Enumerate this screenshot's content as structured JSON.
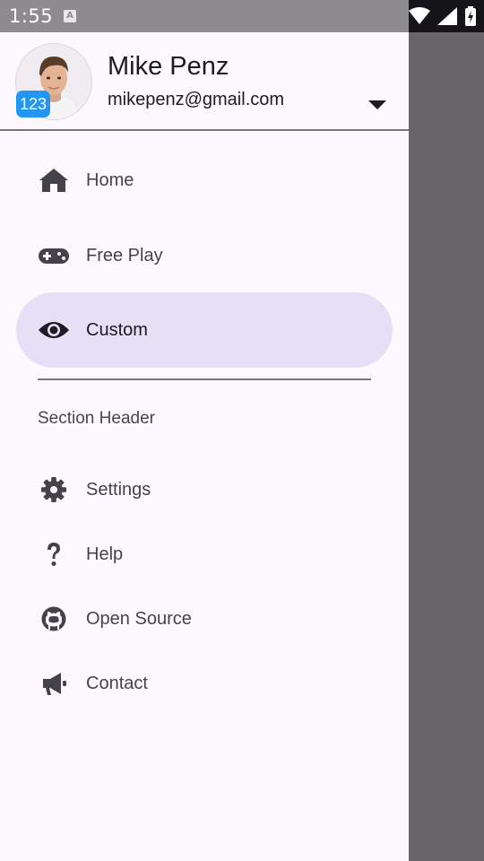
{
  "status_bar": {
    "time": "1:55",
    "a_icon": "A"
  },
  "profile": {
    "name": "Mike Penz",
    "email": "mikepenz@gmail.com",
    "badge": "123"
  },
  "nav": {
    "items": [
      {
        "label": "Home",
        "icon": "home-icon",
        "selected": false
      },
      {
        "label": "Free Play",
        "icon": "gamepad-icon",
        "selected": false
      },
      {
        "label": "Custom",
        "icon": "eye-icon",
        "selected": true
      }
    ],
    "section_header": "Section Header",
    "secondary_items": [
      {
        "label": "Settings",
        "icon": "gear-icon"
      },
      {
        "label": "Help",
        "icon": "question-icon"
      },
      {
        "label": "Open Source",
        "icon": "github-icon"
      },
      {
        "label": "Contact",
        "icon": "bullhorn-icon"
      }
    ]
  },
  "colors": {
    "drawer_bg": "#fdf7fe",
    "selected_bg": "#e6dff5",
    "badge_bg": "#2196f3",
    "scrim": "#676569"
  }
}
